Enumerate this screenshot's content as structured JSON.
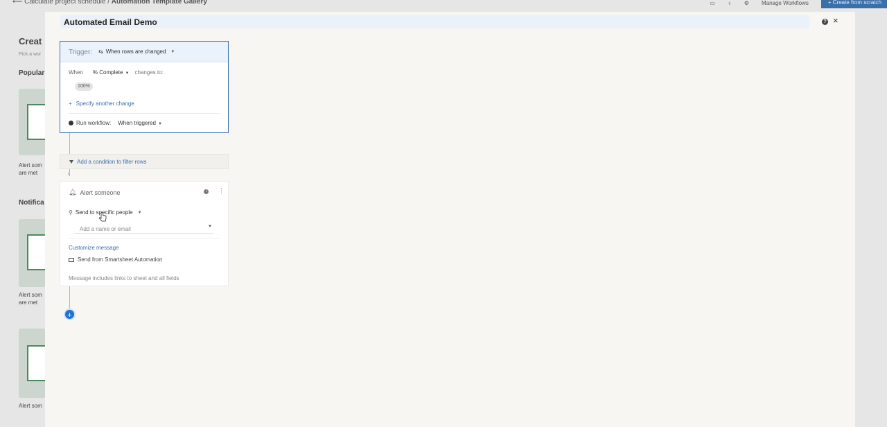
{
  "background": {
    "breadcrumb_prefix": "Calculate project schedule",
    "breadcrumb_sep": "/",
    "breadcrumb_current": "Automation Template Gallery",
    "manage_workflows": "Manage Workflows",
    "create_from_scratch": "Create from scratch",
    "page_title": "Creat",
    "page_sub": "Pick a wor",
    "section_popular": "Popular",
    "section_notifications": "Notifica",
    "card1_caption_l1": "Alert som",
    "card1_caption_l2": "are met",
    "card2_caption_l1": "Alert som",
    "card2_caption_l2": "are met",
    "card3_caption": "Alert som"
  },
  "modal": {
    "title": "Automated Email Demo",
    "help_glyph": "?",
    "close_glyph": "×"
  },
  "trigger": {
    "label": "Trigger:",
    "value": "When rows are changed",
    "when_label": "When",
    "field": "% Complete",
    "changes_to": "changes to:",
    "chip_value": "100%",
    "specify_plus": "+",
    "specify_label": "Specify another change",
    "run_label": "Run workflow:",
    "run_value": "When triggered"
  },
  "condition": {
    "label": "Add a condition to filter rows"
  },
  "action": {
    "title": "Alert someone",
    "send_to": "Send to specific people",
    "recipient_placeholder": "Add a name or email",
    "customize": "Customize message",
    "send_from": "Send from Smartsheet Automation",
    "message_includes": "Message includes links to sheet and all fields"
  },
  "add_block_glyph": "+",
  "colors": {
    "accent": "#1e72d2",
    "link": "#3c6fb0",
    "trigger_border": "#3c6fb0"
  }
}
